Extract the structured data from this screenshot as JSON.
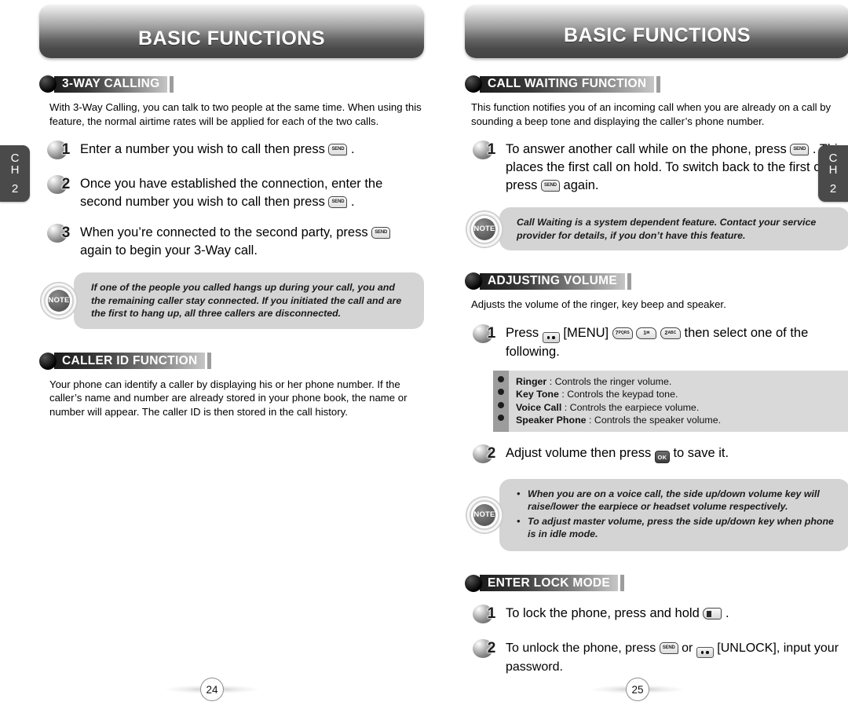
{
  "chapter_tab": {
    "ch_label_c": "C",
    "ch_label_h": "H",
    "number": "2"
  },
  "left_page": {
    "banner_title": "BASIC FUNCTIONS",
    "page_number": "24",
    "sections": [
      {
        "heading": "3-WAY CALLING",
        "intro": "With 3-Way Calling, you can talk to two people at the same time. When using this feature, the normal airtime rates will be applied for each of the two calls.",
        "steps": [
          {
            "num": "1",
            "part1": "Enter a number you wish to call then press",
            "key": "SEND",
            "part2": "."
          },
          {
            "num": "2",
            "part1": "Once you have established the connection, enter the second number you wish to call then press",
            "key": "SEND",
            "part2": "."
          },
          {
            "num": "3",
            "part1": "When you’re connected to the second party, press",
            "key": "SEND",
            "part2": "again to begin your 3-Way call."
          }
        ],
        "note": {
          "badge": "NOTE",
          "text": "If one of the people you called hangs up during your call, you and the remaining caller stay connected. If you initiated the call and are the first to hang up, all three callers are disconnected."
        }
      },
      {
        "heading": "CALLER ID FUNCTION",
        "intro": "Your phone can identify a caller by displaying his or her phone number. If the caller’s name and number are already stored in your phone book, the name or number will appear. The caller ID is then stored in the call history."
      }
    ]
  },
  "right_page": {
    "banner_title": "BASIC FUNCTIONS",
    "page_number": "25",
    "sections": [
      {
        "heading": "CALL WAITING FUNCTION",
        "intro": "This function notifies you of an incoming call when you are already on a call by sounding a beep tone and displaying the caller’s phone number.",
        "step": {
          "num": "1",
          "part1": "To answer another call while on the phone, press",
          "key1": "SEND",
          "part2": ". This places the first call on hold. To switch back to the first caller, press",
          "key2": "SEND",
          "part3": "again."
        },
        "note": {
          "badge": "NOTE",
          "text": "Call Waiting is a system dependent feature. Contact your service provider for details, if you don’t have this feature."
        }
      },
      {
        "heading": "ADJUSTING VOLUME",
        "intro": "Adjusts the volume of the ringer, key beep and speaker.",
        "step1": {
          "num": "1",
          "part1": "Press",
          "menu_key": "••",
          "menu_label": "[MENU]",
          "key7": "7",
          "key7_sub": "PQRS",
          "key1": "1",
          "key1_sub": "✉",
          "key2": "2",
          "key2_sub": "ABC",
          "part2": "then select one of the following."
        },
        "options": [
          {
            "name": "Ringer",
            "desc": ": Controls the ringer volume."
          },
          {
            "name": "Key Tone",
            "desc": ": Controls the keypad tone."
          },
          {
            "name": "Voice Call",
            "desc": ": Controls the earpiece volume."
          },
          {
            "name": "Speaker Phone",
            "desc": ": Controls the speaker volume."
          }
        ],
        "step2": {
          "num": "2",
          "part1": "Adjust volume then press",
          "key": "OK",
          "part2": "to save it."
        },
        "note": {
          "badge": "NOTE",
          "items": [
            "When you are on a voice call, the side up/down volume key will raise/lower the earpiece or headset volume respectively.",
            "To adjust master volume, press the side up/down key when phone is in idle mode."
          ],
          "bullet": "•"
        }
      },
      {
        "heading": "ENTER LOCK MODE",
        "steps": [
          {
            "num": "1",
            "part1": "To lock the phone, press and hold",
            "key": "lock",
            "part2": "."
          },
          {
            "num": "2",
            "part1": "To unlock the phone, press",
            "key1": "SEND",
            "mid": "or",
            "key2": "••",
            "label": "[UNLOCK],",
            "part2": "input your password."
          }
        ]
      }
    ]
  }
}
